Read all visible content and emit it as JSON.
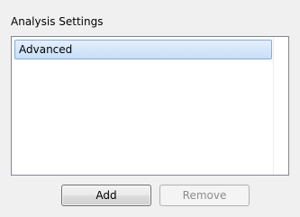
{
  "group": {
    "title": "Analysis Settings"
  },
  "list": {
    "items": [
      {
        "label": "Advanced",
        "selected": true
      }
    ]
  },
  "buttons": {
    "add_label": "Add",
    "remove_label": "Remove",
    "remove_enabled": false
  },
  "colors": {
    "panel_background": "#f0f0f0",
    "selection_border": "#84acdd",
    "selection_fill": "#d5e6f9",
    "disabled_text": "#8d8d8d"
  }
}
